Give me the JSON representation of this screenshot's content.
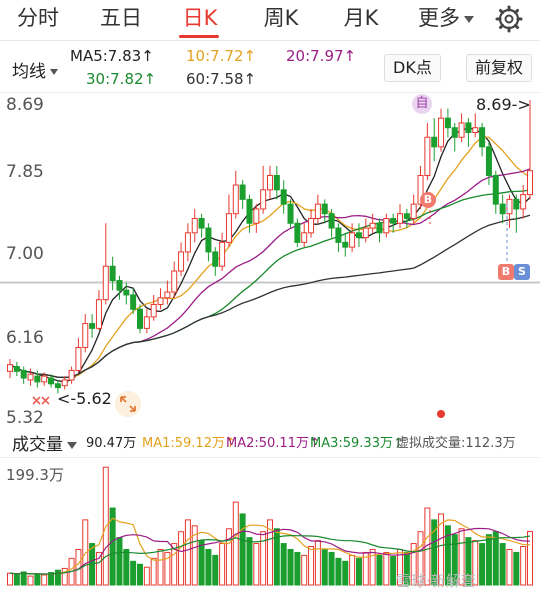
{
  "tabs": [
    {
      "label": "分时",
      "active": false
    },
    {
      "label": "五日",
      "active": false
    },
    {
      "label": "日K",
      "active": true
    },
    {
      "label": "周K",
      "active": false
    },
    {
      "label": "月K",
      "active": false
    },
    {
      "label": "更多",
      "active": false
    }
  ],
  "settings_icon": "gear-icon",
  "ma_bar": {
    "selector": "均线",
    "ma5": "MA5:7.83",
    "ma10": "10:7.72",
    "ma20": "20:7.97",
    "ma30": "30:7.82",
    "ma60": "60:7.58",
    "arrow": "↑",
    "dk_button": "DK点",
    "adjust_button": "前复权"
  },
  "colors": {
    "up": "#e8382f",
    "down": "#1a9e2e",
    "ma5": "#222222",
    "ma10": "#e3a11f",
    "ma20": "#9c1d87",
    "ma30": "#1a8a2e",
    "ma60": "#333333",
    "accent": "#e8382f"
  },
  "price_axis": {
    "labels": [
      "8.69",
      "7.85",
      "7.00",
      "6.16",
      "5.32"
    ]
  },
  "annotations": {
    "high_label": "8.69->",
    "low_label": "<-5.62",
    "self_badge": "自",
    "buy_badge": "B",
    "sell_badge": "S"
  },
  "volume_bar": {
    "label": "成交量",
    "vol": "90.47万",
    "ma1": "MA1:59.12万",
    "ma2": "MA2:50.11万",
    "ma3": "MA3:59.33万",
    "virtual": "虚拟成交量:112.3万",
    "arrow": "↑",
    "max_label": "199.3万"
  },
  "watermark": "雪球·新解套",
  "chart_data": {
    "type": "candlestick",
    "y_range": [
      5.32,
      8.69
    ],
    "max_price": 8.69,
    "min_price": 5.62,
    "reference_line": 7.0,
    "series_names": [
      "MA5",
      "MA10",
      "MA20",
      "MA30",
      "MA60"
    ],
    "candles": [
      [
        5.85,
        5.92,
        5.98,
        5.78
      ],
      [
        5.9,
        5.85,
        5.95,
        5.8
      ],
      [
        5.86,
        5.78,
        5.9,
        5.72
      ],
      [
        5.76,
        5.82,
        5.88,
        5.7
      ],
      [
        5.8,
        5.74,
        5.86,
        5.68
      ],
      [
        5.74,
        5.8,
        5.84,
        5.7
      ],
      [
        5.78,
        5.72,
        5.82,
        5.68
      ],
      [
        5.72,
        5.68,
        5.76,
        5.62
      ],
      [
        5.7,
        5.76,
        5.8,
        5.66
      ],
      [
        5.76,
        5.86,
        5.9,
        5.72
      ],
      [
        5.86,
        6.1,
        6.2,
        5.84
      ],
      [
        6.1,
        6.35,
        6.45,
        6.05
      ],
      [
        6.35,
        6.3,
        6.45,
        6.2
      ],
      [
        6.3,
        6.6,
        6.7,
        6.28
      ],
      [
        6.6,
        6.95,
        7.4,
        6.55
      ],
      [
        6.95,
        6.8,
        7.05,
        6.7
      ],
      [
        6.8,
        6.7,
        6.85,
        6.6
      ],
      [
        6.7,
        6.65,
        6.78,
        6.55
      ],
      [
        6.65,
        6.5,
        6.72,
        6.45
      ],
      [
        6.5,
        6.3,
        6.55,
        6.25
      ],
      [
        6.3,
        6.42,
        6.5,
        6.25
      ],
      [
        6.42,
        6.55,
        6.65,
        6.38
      ],
      [
        6.55,
        6.62,
        6.72,
        6.5
      ],
      [
        6.62,
        6.68,
        6.8,
        6.55
      ],
      [
        6.68,
        6.9,
        7.0,
        6.62
      ],
      [
        6.9,
        7.1,
        7.2,
        6.85
      ],
      [
        7.1,
        7.3,
        7.4,
        7.0
      ],
      [
        7.3,
        7.45,
        7.55,
        7.2
      ],
      [
        7.45,
        7.35,
        7.5,
        7.25
      ],
      [
        7.35,
        7.1,
        7.4,
        7.0
      ],
      [
        7.1,
        6.95,
        7.15,
        6.85
      ],
      [
        6.95,
        7.2,
        7.3,
        6.9
      ],
      [
        7.2,
        7.5,
        7.7,
        7.15
      ],
      [
        7.5,
        7.8,
        7.95,
        7.45
      ],
      [
        7.8,
        7.65,
        7.85,
        7.55
      ],
      [
        7.65,
        7.4,
        7.7,
        7.3
      ],
      [
        7.4,
        7.55,
        7.6,
        7.3
      ],
      [
        7.55,
        7.75,
        8.0,
        7.5
      ],
      [
        7.75,
        7.9,
        8.0,
        7.65
      ],
      [
        7.9,
        7.75,
        8.0,
        7.65
      ],
      [
        7.75,
        7.6,
        7.85,
        7.5
      ],
      [
        7.6,
        7.4,
        7.65,
        7.35
      ],
      [
        7.4,
        7.2,
        7.45,
        7.15
      ],
      [
        7.2,
        7.3,
        7.4,
        7.15
      ],
      [
        7.3,
        7.45,
        7.55,
        7.25
      ],
      [
        7.45,
        7.6,
        7.7,
        7.4
      ],
      [
        7.6,
        7.5,
        7.65,
        7.4
      ],
      [
        7.5,
        7.35,
        7.55,
        7.25
      ],
      [
        7.35,
        7.2,
        7.4,
        7.1
      ],
      [
        7.2,
        7.15,
        7.3,
        7.05
      ],
      [
        7.15,
        7.3,
        7.4,
        7.1
      ],
      [
        7.3,
        7.25,
        7.4,
        7.15
      ],
      [
        7.25,
        7.35,
        7.45,
        7.2
      ],
      [
        7.35,
        7.4,
        7.5,
        7.3
      ],
      [
        7.4,
        7.3,
        7.45,
        7.2
      ],
      [
        7.3,
        7.45,
        7.5,
        7.25
      ],
      [
        7.45,
        7.4,
        7.5,
        7.3
      ],
      [
        7.4,
        7.5,
        7.6,
        7.35
      ],
      [
        7.5,
        7.45,
        7.55,
        7.35
      ],
      [
        7.45,
        7.6,
        7.7,
        7.4
      ],
      [
        7.6,
        7.9,
        8.0,
        7.55
      ],
      [
        7.9,
        8.3,
        8.45,
        7.85
      ],
      [
        8.3,
        8.2,
        8.5,
        8.05
      ],
      [
        8.2,
        8.5,
        8.6,
        8.15
      ],
      [
        8.5,
        8.4,
        8.6,
        8.3
      ],
      [
        8.4,
        8.3,
        8.45,
        8.15
      ],
      [
        8.3,
        8.45,
        8.55,
        8.25
      ],
      [
        8.45,
        8.35,
        8.5,
        8.2
      ],
      [
        8.35,
        8.4,
        8.55,
        8.3
      ],
      [
        8.4,
        8.2,
        8.45,
        8.1
      ],
      [
        8.2,
        7.9,
        8.25,
        7.8
      ],
      [
        7.9,
        7.6,
        7.95,
        7.5
      ],
      [
        7.6,
        7.5,
        7.7,
        7.4
      ],
      [
        7.5,
        7.65,
        7.7,
        7.35
      ],
      [
        7.65,
        7.55,
        7.7,
        7.3
      ],
      [
        7.55,
        7.7,
        7.8,
        7.45
      ],
      [
        7.7,
        7.95,
        8.69,
        7.65
      ]
    ],
    "volumes": [
      20,
      18,
      22,
      15,
      19,
      17,
      21,
      25,
      28,
      45,
      60,
      110,
      70,
      55,
      199,
      130,
      80,
      60,
      40,
      35,
      30,
      45,
      60,
      55,
      70,
      90,
      110,
      100,
      75,
      60,
      50,
      70,
      95,
      140,
      120,
      80,
      70,
      90,
      110,
      95,
      70,
      60,
      55,
      50,
      65,
      75,
      60,
      55,
      45,
      40,
      50,
      45,
      55,
      60,
      50,
      55,
      48,
      60,
      55,
      70,
      90,
      130,
      110,
      120,
      100,
      85,
      95,
      80,
      75,
      70,
      85,
      90,
      70,
      60,
      55,
      65,
      90.47
    ],
    "volume_max": 199.3
  }
}
